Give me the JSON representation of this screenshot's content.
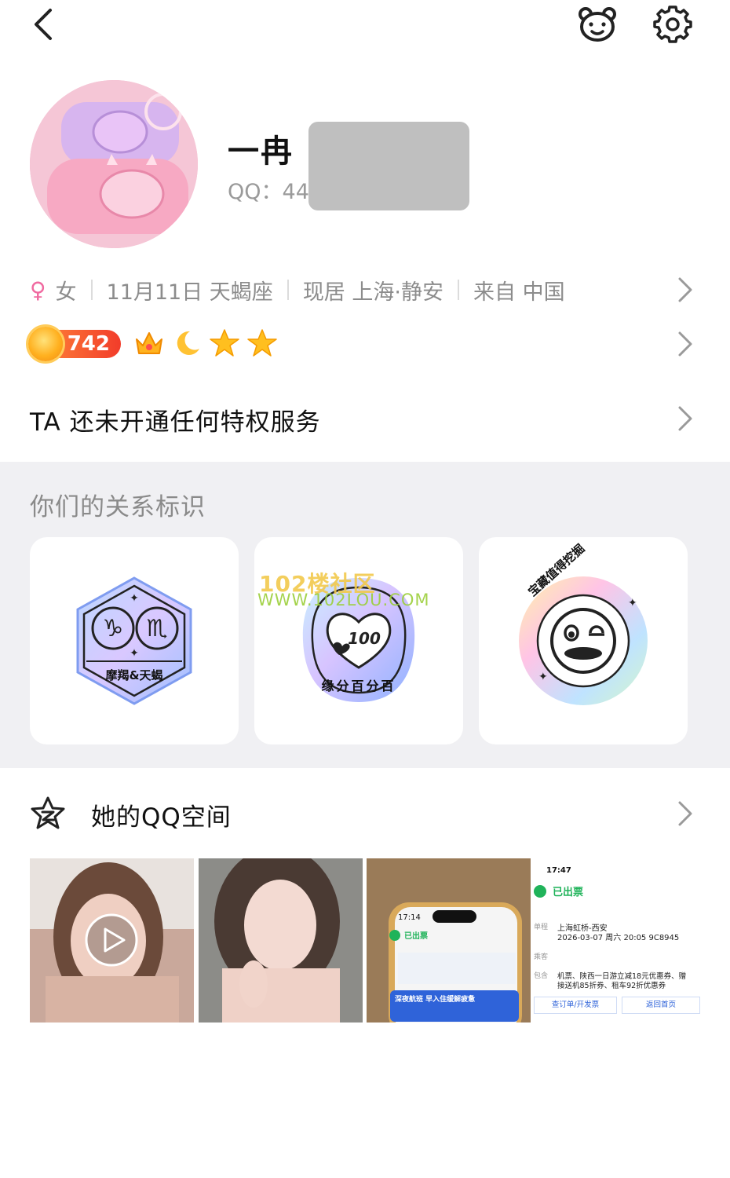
{
  "header": {
    "back_icon": "chevron-left-icon",
    "bear_icon": "bear-face-icon",
    "settings_icon": "gear-icon"
  },
  "profile": {
    "nickname": "一冉",
    "qq_label": "QQ：",
    "qq_visible": "44",
    "gender_symbol": "♀",
    "gender": "女",
    "birthday_sign": "11月11日 天蝎座",
    "residence": "现居 上海·静安",
    "origin": "来自 中国",
    "level": "742",
    "badges": [
      "crown-icon",
      "moon-icon",
      "star-icon",
      "star-icon"
    ]
  },
  "privilege": {
    "text": "TA 还未开通任何特权服务"
  },
  "relationship": {
    "title": "你们的关系标识",
    "cards": [
      {
        "icon": "capricorn-scorpio-badge",
        "label": "摩羯&天蝎"
      },
      {
        "icon": "heart-100-badge",
        "label": "缘分百分百"
      },
      {
        "icon": "treasure-dig-badge",
        "label": "宝藏值得挖掘"
      }
    ]
  },
  "watermark": {
    "line1": "102楼社区",
    "line2": "WWW.102LOU.COM"
  },
  "qzone": {
    "title": "她的QQ空间",
    "photos": [
      {
        "type": "video"
      },
      {
        "type": "photo"
      },
      {
        "type": "phone-screenshot",
        "time": "17:14",
        "status": "已出票",
        "banner": "深夜航班 早入住缓解疲惫"
      },
      {
        "type": "ticket-screenshot",
        "time": "17:47",
        "status": "已出票",
        "route_label": "单程",
        "route": "上海虹桥-西安",
        "datetime": "2026-03-07 周六 20:05 9C8945",
        "passenger_label": "乘客",
        "package_label": "包含",
        "package_line1": "机票、陕西一日游立减18元优惠券、赠",
        "package_line2": "接送机85折券、租车92折优惠券",
        "btn_invoice": "查订单/开发票",
        "btn_home": "返回首页"
      }
    ]
  },
  "colors": {
    "accent_pink": "#f06aa0",
    "level_orange": "#f23c2a",
    "section_gray": "#f0f0f3"
  }
}
